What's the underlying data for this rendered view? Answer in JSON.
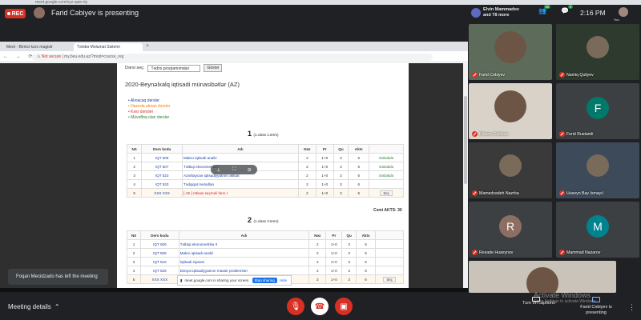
{
  "browser": {
    "url_strip": "meet.google.com/xyz-qwe-rty"
  },
  "meet": {
    "rec_label": "REC",
    "presenter_text": "Farid Cəbiyev is presenting",
    "header_names": [
      "Elvin Mammadov",
      "and 78 more"
    ],
    "participant_count": "98",
    "chat_badge": "2",
    "clock": "2:16 PM",
    "you_label": "You",
    "toast": "Foqan Mecidzado has left the meeting",
    "meeting_details": "Meeting details",
    "captions_label": "Turn on captions",
    "present_label": "Farid Cəbiyev is presenting",
    "activate_windows": "Activate Windows",
    "activate_sub": "Go to Settings to activate Windows."
  },
  "shared_browser": {
    "tab1": "Meet - Birinci kurs magistr",
    "tab2": "Tələbə Məlumat Sistemi",
    "not_secure": "Not secure",
    "address": "my.beu.edu.az/?mod=course_reg"
  },
  "page": {
    "filter_label": "Dərsi seç:",
    "filter_value": "Tədris proqramımdan",
    "filter_button": "Göstər",
    "heading": "2020-Beynəlxalq iqtisadi münasibətlər (AZ)",
    "legend": [
      {
        "text": "Alınacaq dərslər",
        "color": "#1a3faa"
      },
      {
        "text": "Hazırda alınan dərslər",
        "color": "#f57c00"
      },
      {
        "text": "Kəsr dərsləri",
        "color": "#d32f2f"
      },
      {
        "text": "Müvəffəq olan dərslər",
        "color": "#2e7d32"
      }
    ],
    "semester1": {
      "num": "1",
      "label": "(1.class 1.term)"
    },
    "semester2": {
      "num": "2",
      "label": "(1.class 2.term)"
    },
    "total_label": "Cəmi AKTS: 30",
    "columns": [
      "Nö",
      "Ders kodu",
      "Adı",
      "Nəz",
      "Pr",
      "Qu",
      "Akts",
      ""
    ],
    "table1": [
      {
        "n": "1",
        "code": "IQT 505",
        "name": "Makro iqtisadi analiz",
        "nez": "2",
        "pr": "1+0",
        "qu": "3",
        "akts": "6",
        "status": "Səbəbdə"
      },
      {
        "n": "2",
        "code": "IQT 507",
        "name": "Tətbiqi ekonometrika I",
        "nez": "2",
        "pr": "1+0",
        "qu": "3",
        "akts": "6",
        "status": "Səbəbdə"
      },
      {
        "n": "3",
        "code": "IQT 523",
        "name": "Azərbaycan iqtisadiyyatının aktual",
        "nez": "2",
        "pr": "1+0",
        "qu": "3",
        "akts": "6",
        "status": "Səbəbdə"
      },
      {
        "n": "4",
        "code": "IQT 533",
        "name": "Tədqiqat metodları",
        "nez": "2",
        "pr": "1+0",
        "qu": "3",
        "akts": "6",
        "status": ""
      },
      {
        "n": "5",
        "code": "XXX XXX",
        "name": "[ AE ] Istisas seçməli fənn I",
        "nez": "2",
        "pr": "1+0",
        "qu": "3",
        "akts": "6",
        "status": "Seç"
      }
    ],
    "table2": [
      {
        "n": "1",
        "code": "IQT 506",
        "name": "Tətbiqi ekonometrika II",
        "nez": "2",
        "pr": "1+0",
        "qu": "3",
        "akts": "6",
        "status": ""
      },
      {
        "n": "2",
        "code": "IQT 508",
        "name": "Makro iqtisadi analiz",
        "nez": "2",
        "pr": "1+0",
        "qu": "3",
        "akts": "6",
        "status": ""
      },
      {
        "n": "3",
        "code": "IQT 516",
        "name": "İqtisadi siyasət",
        "nez": "2",
        "pr": "1+0",
        "qu": "3",
        "akts": "6",
        "status": ""
      },
      {
        "n": "4",
        "code": "IQT 526",
        "name": "Dünya iqtisadiyyatının müasir problemləri",
        "nez": "2",
        "pr": "1+0",
        "qu": "3",
        "akts": "6",
        "status": ""
      },
      {
        "n": "5",
        "code": "XXX XXX",
        "name": "",
        "nez": "3",
        "pr": "1+0",
        "qu": "3",
        "akts": "6",
        "status": "Seç"
      }
    ],
    "share_notice": "meet.google.com is sharing your screen.",
    "stop_sharing": "Stop sharing",
    "hide": "Hide"
  },
  "participants": [
    {
      "name": "Farid Cəbiyev",
      "type": "video",
      "bg": "#5d6b5a"
    },
    {
      "name": "Namiq Quliyev",
      "type": "photo",
      "bg": "#2f3a2f"
    },
    {
      "name": "Efsane Celilova",
      "type": "video",
      "bg": "#d8d2c8"
    },
    {
      "name": "Ferid Rustamli",
      "type": "letter",
      "letter": "F",
      "bg": "#00796b"
    },
    {
      "name": "Mamedzadeh Nazrba",
      "type": "photo",
      "bg": "#3a3a3a"
    },
    {
      "name": "Huseyn Bay Ismayıl",
      "type": "photo",
      "bg": "#3c4a5a"
    },
    {
      "name": "Resade Huseynov",
      "type": "letter",
      "letter": "R",
      "bg": "#8d6e63"
    },
    {
      "name": "Mammad Nazarov",
      "type": "letter",
      "letter": "M",
      "bg": "#00838f"
    },
    {
      "name": "",
      "type": "video",
      "bg": "#c9c3b9"
    }
  ]
}
